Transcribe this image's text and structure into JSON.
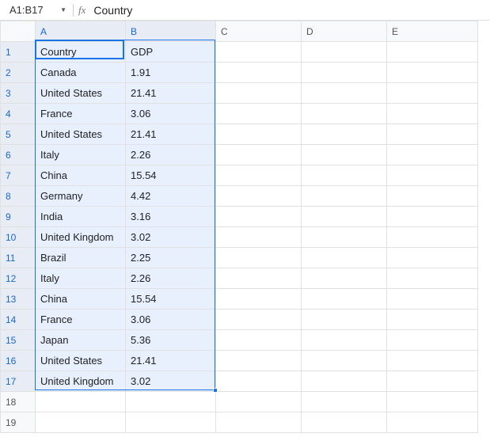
{
  "nameBox": "A1:B17",
  "fxLabel": "fx",
  "formulaBar": "Country",
  "columns": [
    "A",
    "B",
    "C",
    "D",
    "E"
  ],
  "selectedCols": [
    "A",
    "B"
  ],
  "rowCount": 19,
  "selectedRowMax": 17,
  "headers": {
    "A": "Country",
    "B": "GDP"
  },
  "rows": [
    {
      "A": "Canada",
      "B": "1.91"
    },
    {
      "A": "United States",
      "B": "21.41"
    },
    {
      "A": "France",
      "B": "3.06"
    },
    {
      "A": "United States",
      "B": "21.41"
    },
    {
      "A": "Italy",
      "B": "2.26"
    },
    {
      "A": "China",
      "B": "15.54"
    },
    {
      "A": "Germany",
      "B": "4.42"
    },
    {
      "A": "India",
      "B": "3.16"
    },
    {
      "A": "United Kingdom",
      "B": "3.02"
    },
    {
      "A": "Brazil",
      "B": "2.25"
    },
    {
      "A": "Italy",
      "B": "2.26"
    },
    {
      "A": "China",
      "B": "15.54"
    },
    {
      "A": "France",
      "B": "3.06"
    },
    {
      "A": "Japan",
      "B": "5.36"
    },
    {
      "A": "United States",
      "B": "21.41"
    },
    {
      "A": "United Kingdom",
      "B": "3.02"
    }
  ]
}
